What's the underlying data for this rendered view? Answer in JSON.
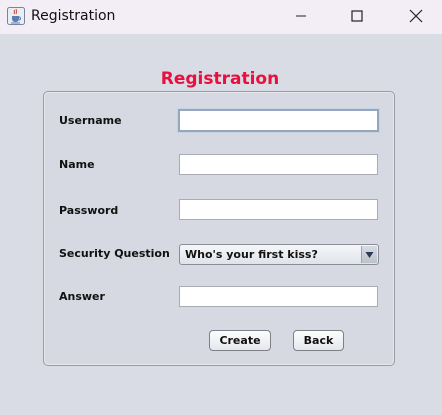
{
  "window": {
    "title": "Registration",
    "icon": "java-cup-icon"
  },
  "form": {
    "heading": "Registration",
    "heading_color": "#e8103f",
    "username_label": "Username",
    "username_value": "",
    "name_label": "Name",
    "name_value": "",
    "password_label": "Password",
    "password_value": "",
    "security_label": "Security Question",
    "security_selected": "Who's your first kiss?",
    "answer_label": "Answer",
    "answer_value": ""
  },
  "buttons": {
    "create_label": "Create",
    "back_label": "Back"
  }
}
